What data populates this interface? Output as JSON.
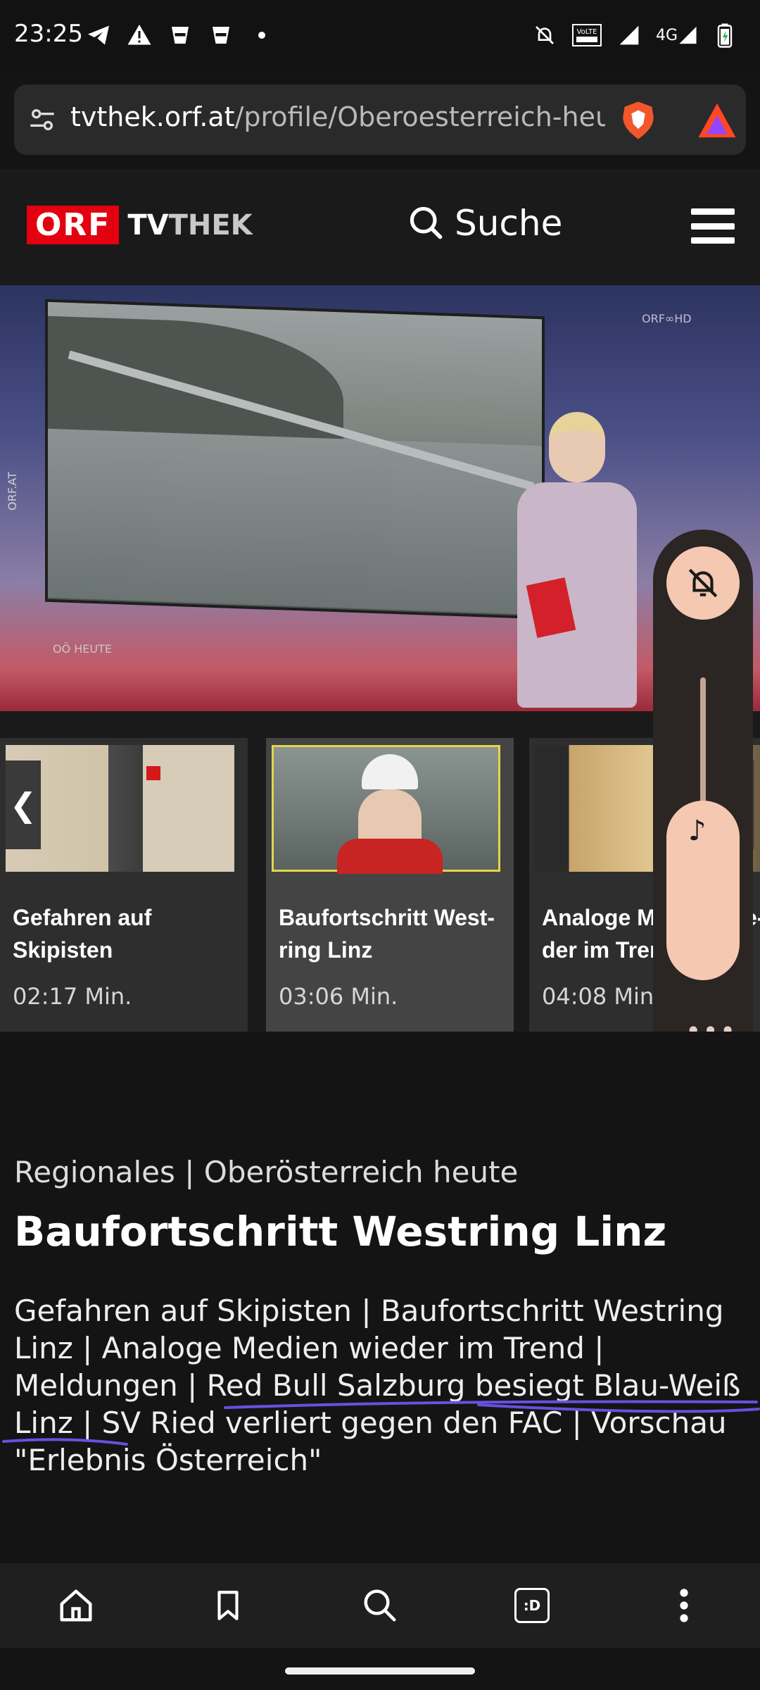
{
  "status_bar": {
    "time": "23:25",
    "network": "4G",
    "volte": "VoLTE",
    "notif_icons": [
      "telegram-icon",
      "warning-icon",
      "willhaben-icon",
      "willhaben-icon",
      "dot-icon"
    ],
    "system_icons": [
      "mute-icon",
      "volte-icon",
      "signal-icon",
      "4g-signal-icon",
      "battery-icon"
    ]
  },
  "browser": {
    "url_host": "tvthek.orf.at",
    "url_path": "/profile/Oberoesterreich-heut"
  },
  "site": {
    "logo_orf": "ORF",
    "logo_tv": "TV",
    "logo_thek": "THEK",
    "search_label": "Suche"
  },
  "video": {
    "bug_top_right": "ORF∞HD",
    "bug_bottom_left": "OÖ HEUTE",
    "side_text": "ORF.AT"
  },
  "carousel": {
    "items": [
      {
        "title": "Gefahren auf Skipisten",
        "duration": "02:17 Min.",
        "active": false
      },
      {
        "title": "Baufortschritt West-ring Linz",
        "duration": "03:06 Min.",
        "active": true
      },
      {
        "title": "Analoge Medien wie-der im Trend",
        "duration": "04:08 Min.",
        "active": false
      }
    ],
    "prev_label": "❮",
    "next_label": "❯"
  },
  "volume_panel": {
    "more_label": "•••"
  },
  "article": {
    "breadcrumb": "Regionales | Oberösterreich heute",
    "headline": "Baufortschritt Westring Linz",
    "description": "Gefahren auf Skipisten | Baufortschritt Westring Linz | Analoge Medien wieder im Trend | Meldungen | Red Bull Salzburg besiegt Blau-Weiß Linz | SV Ried verliert gegen den FAC | Vorschau \"Erlebnis Österreich\""
  },
  "bottom_bar": {
    "items": [
      "home-icon",
      "bookmark-icon",
      "search-icon",
      "tabs-icon",
      "menu-icon"
    ],
    "tabs_label": ":D"
  },
  "colors": {
    "orf_red": "#e3000f",
    "active_outline": "#e3d54a",
    "volume_accent": "#f5c8b2",
    "scribble": "#6a4fe0"
  }
}
